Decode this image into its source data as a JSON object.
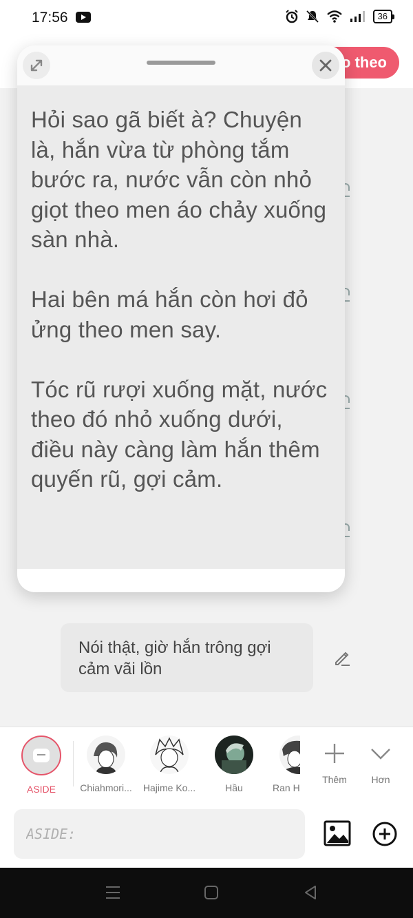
{
  "status_bar": {
    "time": "17:56",
    "battery": "36",
    "icons": [
      "youtube-icon",
      "alarm-icon",
      "mute-icon",
      "wifi-icon",
      "signal-icon",
      "battery-icon"
    ]
  },
  "header": {
    "follow_label": "o theo"
  },
  "popup": {
    "paragraphs": [
      "Hỏi sao gã biết à? Chuyện là, hắn vừa từ phòng tắm bước ra, nước vẫn còn nhỏ giọt theo men áo chảy xuống sàn nhà.",
      "Hai bên má hắn còn hơi đỏ ửng theo men say.",
      "Tóc rũ rượi xuống mặt, nước theo đó nhỏ xuống dưới, điều này càng làm hắn thêm quyến rũ, gợi cảm."
    ]
  },
  "message": {
    "text": "Nói thật, giờ hắn trông gợi cảm vãi lồn"
  },
  "characters": [
    {
      "label": "ASIDE",
      "active": true
    },
    {
      "label": "Chiahmori..."
    },
    {
      "label": "Hajime Ko..."
    },
    {
      "label": "Hầu"
    },
    {
      "label": "Ran H"
    }
  ],
  "actions": {
    "more_label": "Thêm",
    "less_label": "Hơn"
  },
  "input": {
    "placeholder": "ASIDE:"
  },
  "colors": {
    "accent": "#ef5a6f",
    "aside_label": "#e5556a"
  }
}
